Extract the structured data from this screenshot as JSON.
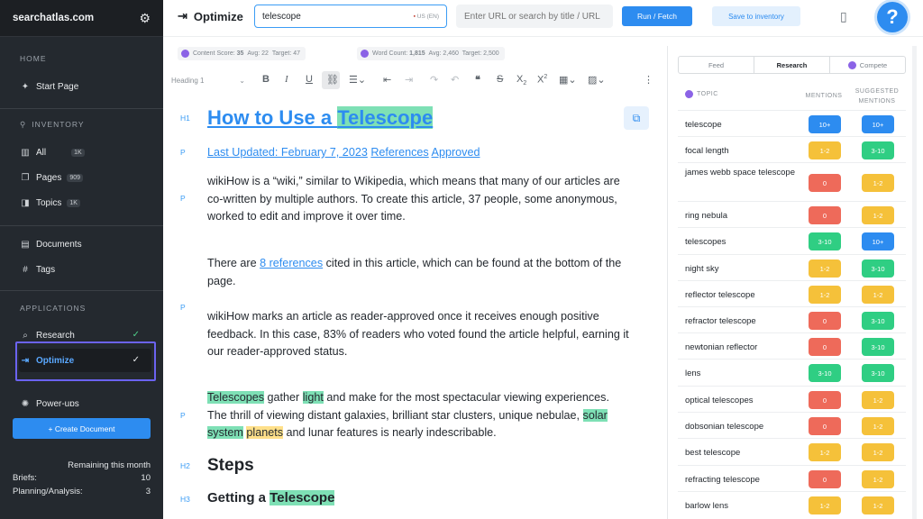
{
  "sidebar": {
    "brand": "searchatlas.com",
    "sections": {
      "home": "HOME",
      "inventory": "INVENTORY",
      "applications": "APPLICATIONS"
    },
    "items": {
      "start": "Start Page",
      "all": "All",
      "all_count": "1K",
      "pages": "Pages",
      "pages_count": "909",
      "topics": "Topics",
      "topics_count": "1K",
      "documents": "Documents",
      "tags": "Tags",
      "research": "Research",
      "optimize": "Optimize",
      "powerups": "Power-ups"
    },
    "create_button": "+ Create Document",
    "remaining": {
      "title": "Remaining this month",
      "briefs_label": "Briefs:",
      "briefs_value": "10",
      "planning_label": "Planning/Analysis:",
      "planning_value": "3"
    }
  },
  "header": {
    "title": "Optimize",
    "keyword": "telescope",
    "locale": "US (EN)",
    "url_placeholder": "Enter URL or search by title / URL",
    "run_button": "Run / Fetch",
    "save_button": "Save to inventory",
    "help": "?"
  },
  "scores": {
    "content_label": "Content Score:",
    "content_value": "35",
    "content_avg": "Avg: 22",
    "content_target": "Target: 47",
    "word_label": "Word Count:",
    "word_value": "1,815",
    "word_avg": "Avg: 2,460",
    "word_target": "Target: 2,500"
  },
  "toolbar": {
    "heading": "Heading 1"
  },
  "editor": {
    "tags": {
      "h1": "H1",
      "p": "P",
      "h2": "H2",
      "h3": "H3"
    },
    "h1_pre": "How to Use a ",
    "h1_kw": "Telescope",
    "updated": "Last Updated: February 7, 2023",
    "references": "References",
    "approved": "Approved",
    "p1": "wikiHow is a “wiki,” similar to Wikipedia, which means that many of our articles are co-written by multiple authors. To create this article, 37 people, some anonymous, worked to edit and improve it over time.",
    "p2_pre": "There are ",
    "p2_link": "8 references",
    "p2_post": " cited in this article, which can be found at the bottom of the page.",
    "p3": "wikiHow marks an article as reader-approved once it receives enough positive feedback. In this case, 83% of readers who voted found the article helpful, earning it our reader-approved status.",
    "p4_a": "Telescopes",
    "p4_b": " gather ",
    "p4_c": "light",
    "p4_d": " and make for the most spectacular viewing experiences. The thrill of viewing distant galaxies, brilliant star clusters, unique nebulae, ",
    "p4_e": "solar system",
    "p4_f": " ",
    "p4_g": "planets",
    "p4_h": " and lunar features is nearly indescribable.",
    "h2": "Steps",
    "h3_pre": "Getting a ",
    "h3_kw": "Telescope"
  },
  "panel": {
    "tabs": [
      "Feed",
      "Research",
      "Compete"
    ],
    "col_topic": "TOPIC",
    "col_mentions": "MENTIONS",
    "col_suggested": "SUGGESTED MENTIONS",
    "rows": [
      {
        "topic": "telescope",
        "mentions": "10+",
        "suggested": "10+"
      },
      {
        "topic": "focal length",
        "mentions": "1-2",
        "suggested": "3-10"
      },
      {
        "topic": "james webb space telescope",
        "mentions": "0",
        "suggested": "1-2"
      },
      {
        "topic": "ring nebula",
        "mentions": "0",
        "suggested": "1-2"
      },
      {
        "topic": "telescopes",
        "mentions": "3-10",
        "suggested": "10+"
      },
      {
        "topic": "night sky",
        "mentions": "1-2",
        "suggested": "3-10"
      },
      {
        "topic": "reflector telescope",
        "mentions": "1-2",
        "suggested": "1-2"
      },
      {
        "topic": "refractor telescope",
        "mentions": "0",
        "suggested": "3-10"
      },
      {
        "topic": "newtonian reflector",
        "mentions": "0",
        "suggested": "3-10"
      },
      {
        "topic": "lens",
        "mentions": "3-10",
        "suggested": "3-10"
      },
      {
        "topic": "optical telescopes",
        "mentions": "0",
        "suggested": "1-2"
      },
      {
        "topic": "dobsonian telescope",
        "mentions": "0",
        "suggested": "1-2"
      },
      {
        "topic": "best telescope",
        "mentions": "1-2",
        "suggested": "1-2"
      },
      {
        "topic": "refracting telescope",
        "mentions": "0",
        "suggested": "1-2"
      },
      {
        "topic": "barlow lens",
        "mentions": "1-2",
        "suggested": "1-2"
      }
    ]
  },
  "colors": {
    "accent": "#2d8cf0",
    "highlight_green": "#7ee0b5",
    "highlight_yellow": "#ffe08a",
    "sidebar_bg": "#24292f"
  }
}
